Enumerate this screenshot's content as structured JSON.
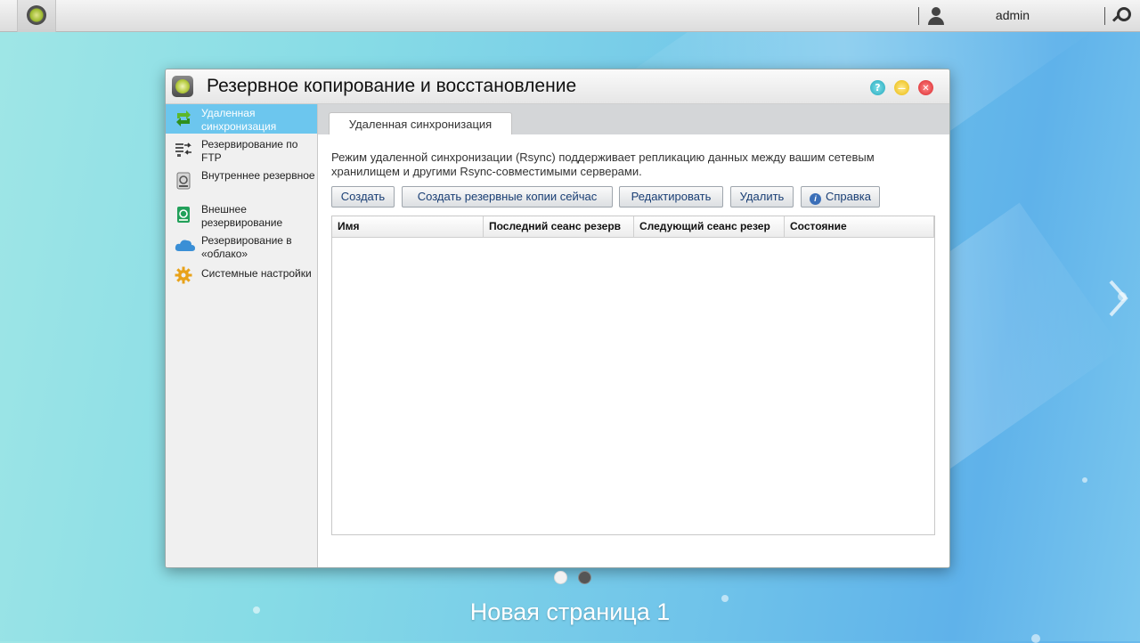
{
  "taskbar": {
    "username": "admin"
  },
  "window": {
    "title": "Резервное копирование и восстановление",
    "help_glyph": "?",
    "min_glyph": "—",
    "close_glyph": "✕"
  },
  "sidebar": {
    "items": [
      {
        "label": "Удаленная синхронизация",
        "icon": "sync-icon"
      },
      {
        "label": "Резервирование по FTP",
        "icon": "ftp-transfer-icon"
      },
      {
        "label": "Внутреннее резервное",
        "icon": "internal-disk-icon"
      },
      {
        "label": "Внешнее резервирование",
        "icon": "external-disk-icon"
      },
      {
        "label": "Резервирование в «облако»",
        "icon": "cloud-icon"
      },
      {
        "label": "Системные настройки",
        "icon": "gear-icon"
      }
    ]
  },
  "tabs": [
    {
      "label": "Удаленная синхронизация"
    }
  ],
  "content": {
    "description": "Режим удаленной синхронизации (Rsync) поддерживает репликацию данных между вашим сетевым хранилищем и другими Rsync-совместимыми серверами.",
    "buttons": {
      "create": "Создать",
      "backup_now": "Создать резервные копии сейчас",
      "edit": "Редактировать",
      "delete": "Удалить",
      "help": "Справка"
    },
    "table": {
      "columns": [
        "Имя",
        "Последний сеанс резерв",
        "Следующий сеанс резер",
        "Состояние"
      ],
      "rows": []
    }
  },
  "desktop": {
    "page_label": "Новая страница 1"
  },
  "colors": {
    "accent": "#6cc6ee",
    "button_text": "#1a3f75"
  }
}
